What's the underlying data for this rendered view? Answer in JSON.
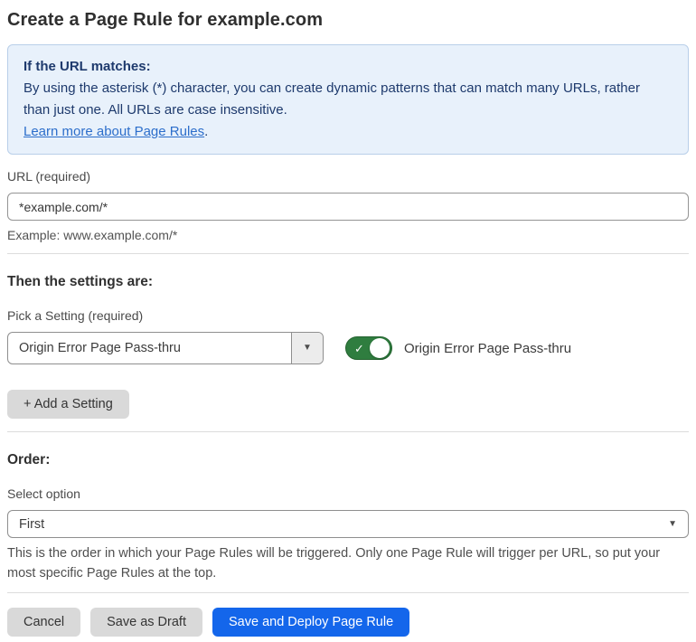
{
  "page": {
    "title": "Create a Page Rule for example.com"
  },
  "info_box": {
    "heading": "If the URL matches:",
    "body": "By using the asterisk (*) character, you can create dynamic patterns that can match many URLs, rather than just one. All URLs are case insensitive.",
    "link_label": "Learn more about Page Rules",
    "link_suffix": "."
  },
  "url_field": {
    "label": "URL (required)",
    "value": "*example.com/*",
    "helper": "Example: www.example.com/*"
  },
  "settings_section": {
    "heading": "Then the settings are:",
    "picker_label": "Pick a Setting (required)",
    "picker_value": "Origin Error Page Pass-thru",
    "toggle_state": "on",
    "toggle_check": "✓",
    "toggle_label": "Origin Error Page Pass-thru",
    "add_setting_label": "+ Add a Setting"
  },
  "order_section": {
    "heading": "Order:",
    "select_label": "Select option",
    "select_value": "First",
    "helper": "This is the order in which your Page Rules will be triggered. Only one Page Rule will trigger per URL, so put your most specific Page Rules at the top."
  },
  "actions": {
    "cancel_label": "Cancel",
    "save_draft_label": "Save as Draft",
    "save_deploy_label": "Save and Deploy Page Rule"
  },
  "icons": {
    "caret_down": "▼"
  },
  "colors": {
    "info_bg": "#e8f1fb",
    "info_border": "#b9cfe9",
    "info_text": "#1e3a6d",
    "link_blue": "#2c6ecb",
    "primary_blue": "#1466eb",
    "toggle_green": "#2f7d3f",
    "button_gray": "#d9d9d9"
  }
}
